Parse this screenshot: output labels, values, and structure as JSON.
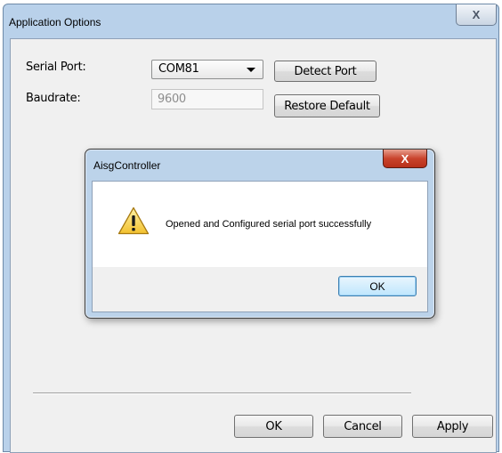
{
  "window": {
    "title": "Application Options",
    "close_glyph": "X",
    "serial_port_label": "Serial Port:",
    "serial_port_value": "COM81",
    "baudrate_label": "Baudrate:",
    "baudrate_value": "9600",
    "detect_port_label": "Detect Port",
    "restore_default_label": "Restore Default",
    "ok_label": "OK",
    "cancel_label": "Cancel",
    "apply_label": "Apply"
  },
  "dialog": {
    "title": "AisgController",
    "close_glyph": "X",
    "icon": "warning-icon",
    "message": "Opened and Configured serial port successfully",
    "ok_label": "OK"
  }
}
